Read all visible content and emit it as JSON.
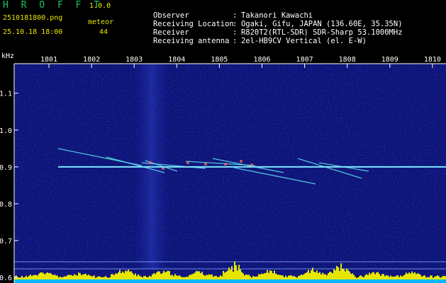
{
  "header": {
    "app_name": "H R O F F T",
    "version": "1.0.0",
    "filename": "2510181800.png",
    "meteor_label": "meteor",
    "datetime": "25.10.18 18:00",
    "meteor_count": "44"
  },
  "station": [
    {
      "key": "Observer",
      "value": "Takanori Kawachi"
    },
    {
      "key": "Receiving Location",
      "value": "Ogaki, Gifu, JAPAN (136.60E, 35.35N)"
    },
    {
      "key": "Receiver",
      "value": "R820T2(RTL-SDR) SDR-Sharp 53.1000MHz"
    },
    {
      "key": "Receiving antenna",
      "value": "2el-HB9CV Vertical (el. E-W)"
    }
  ],
  "spectrogram": {
    "unit_label": "kHz",
    "time_ticks": [
      "1801",
      "1802",
      "1803",
      "1804",
      "1805",
      "1806",
      "1807",
      "1808",
      "1809",
      "1810"
    ],
    "freq_ticks": [
      "1.1",
      "1.0",
      "0.9",
      "0.8",
      "0.7",
      "0.6"
    ],
    "freq_range": [
      0.585,
      1.18
    ],
    "carrier_khz": 0.9,
    "colors": {
      "background": "#0a0f6e",
      "carrier": "#7fe7ff",
      "histogram": "#e6e600",
      "baseline": "#00b7ff",
      "axis": "#ffffff"
    }
  }
}
